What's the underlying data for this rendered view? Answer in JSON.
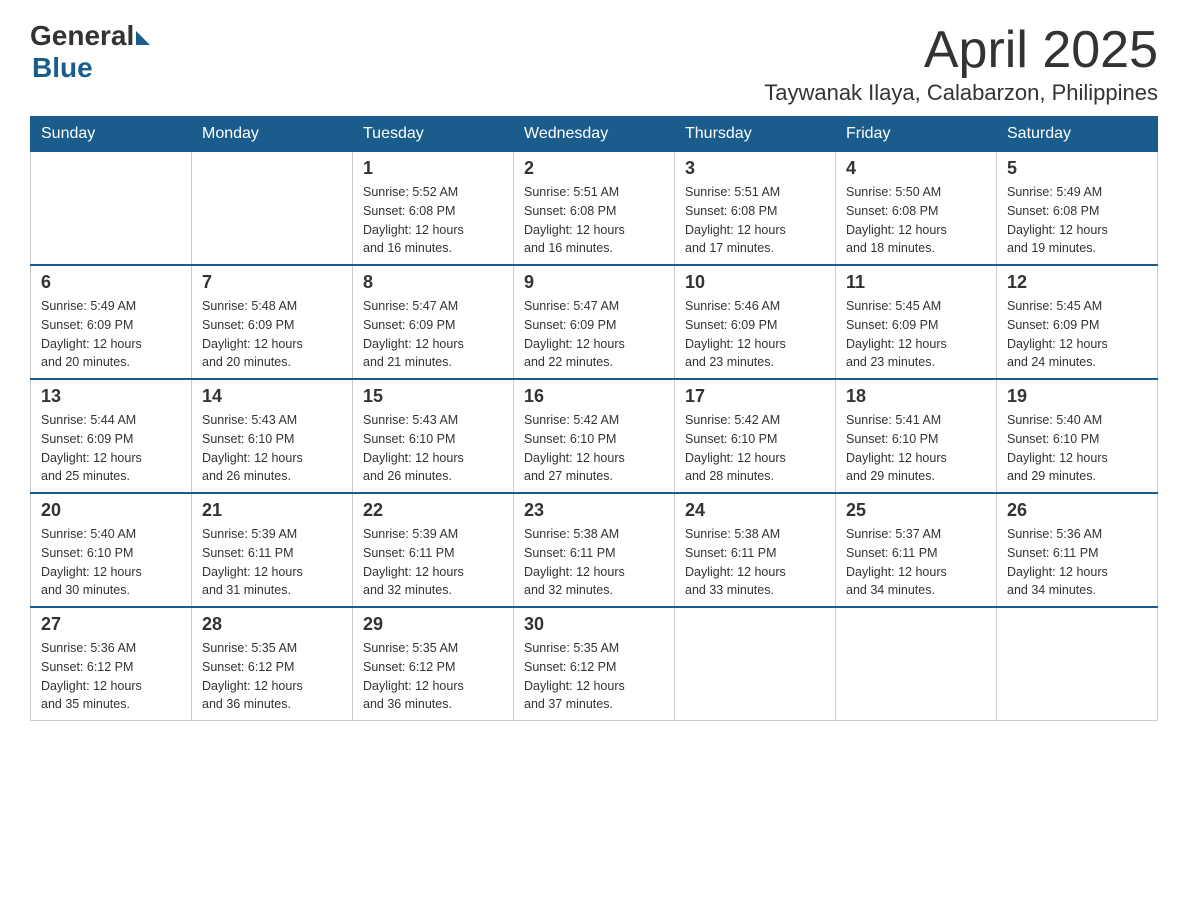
{
  "logo": {
    "general": "General",
    "blue": "Blue"
  },
  "title": "April 2025",
  "location": "Taywanak Ilaya, Calabarzon, Philippines",
  "weekdays": [
    "Sunday",
    "Monday",
    "Tuesday",
    "Wednesday",
    "Thursday",
    "Friday",
    "Saturday"
  ],
  "weeks": [
    [
      {
        "day": "",
        "info": ""
      },
      {
        "day": "",
        "info": ""
      },
      {
        "day": "1",
        "info": "Sunrise: 5:52 AM\nSunset: 6:08 PM\nDaylight: 12 hours\nand 16 minutes."
      },
      {
        "day": "2",
        "info": "Sunrise: 5:51 AM\nSunset: 6:08 PM\nDaylight: 12 hours\nand 16 minutes."
      },
      {
        "day": "3",
        "info": "Sunrise: 5:51 AM\nSunset: 6:08 PM\nDaylight: 12 hours\nand 17 minutes."
      },
      {
        "day": "4",
        "info": "Sunrise: 5:50 AM\nSunset: 6:08 PM\nDaylight: 12 hours\nand 18 minutes."
      },
      {
        "day": "5",
        "info": "Sunrise: 5:49 AM\nSunset: 6:08 PM\nDaylight: 12 hours\nand 19 minutes."
      }
    ],
    [
      {
        "day": "6",
        "info": "Sunrise: 5:49 AM\nSunset: 6:09 PM\nDaylight: 12 hours\nand 20 minutes."
      },
      {
        "day": "7",
        "info": "Sunrise: 5:48 AM\nSunset: 6:09 PM\nDaylight: 12 hours\nand 20 minutes."
      },
      {
        "day": "8",
        "info": "Sunrise: 5:47 AM\nSunset: 6:09 PM\nDaylight: 12 hours\nand 21 minutes."
      },
      {
        "day": "9",
        "info": "Sunrise: 5:47 AM\nSunset: 6:09 PM\nDaylight: 12 hours\nand 22 minutes."
      },
      {
        "day": "10",
        "info": "Sunrise: 5:46 AM\nSunset: 6:09 PM\nDaylight: 12 hours\nand 23 minutes."
      },
      {
        "day": "11",
        "info": "Sunrise: 5:45 AM\nSunset: 6:09 PM\nDaylight: 12 hours\nand 23 minutes."
      },
      {
        "day": "12",
        "info": "Sunrise: 5:45 AM\nSunset: 6:09 PM\nDaylight: 12 hours\nand 24 minutes."
      }
    ],
    [
      {
        "day": "13",
        "info": "Sunrise: 5:44 AM\nSunset: 6:09 PM\nDaylight: 12 hours\nand 25 minutes."
      },
      {
        "day": "14",
        "info": "Sunrise: 5:43 AM\nSunset: 6:10 PM\nDaylight: 12 hours\nand 26 minutes."
      },
      {
        "day": "15",
        "info": "Sunrise: 5:43 AM\nSunset: 6:10 PM\nDaylight: 12 hours\nand 26 minutes."
      },
      {
        "day": "16",
        "info": "Sunrise: 5:42 AM\nSunset: 6:10 PM\nDaylight: 12 hours\nand 27 minutes."
      },
      {
        "day": "17",
        "info": "Sunrise: 5:42 AM\nSunset: 6:10 PM\nDaylight: 12 hours\nand 28 minutes."
      },
      {
        "day": "18",
        "info": "Sunrise: 5:41 AM\nSunset: 6:10 PM\nDaylight: 12 hours\nand 29 minutes."
      },
      {
        "day": "19",
        "info": "Sunrise: 5:40 AM\nSunset: 6:10 PM\nDaylight: 12 hours\nand 29 minutes."
      }
    ],
    [
      {
        "day": "20",
        "info": "Sunrise: 5:40 AM\nSunset: 6:10 PM\nDaylight: 12 hours\nand 30 minutes."
      },
      {
        "day": "21",
        "info": "Sunrise: 5:39 AM\nSunset: 6:11 PM\nDaylight: 12 hours\nand 31 minutes."
      },
      {
        "day": "22",
        "info": "Sunrise: 5:39 AM\nSunset: 6:11 PM\nDaylight: 12 hours\nand 32 minutes."
      },
      {
        "day": "23",
        "info": "Sunrise: 5:38 AM\nSunset: 6:11 PM\nDaylight: 12 hours\nand 32 minutes."
      },
      {
        "day": "24",
        "info": "Sunrise: 5:38 AM\nSunset: 6:11 PM\nDaylight: 12 hours\nand 33 minutes."
      },
      {
        "day": "25",
        "info": "Sunrise: 5:37 AM\nSunset: 6:11 PM\nDaylight: 12 hours\nand 34 minutes."
      },
      {
        "day": "26",
        "info": "Sunrise: 5:36 AM\nSunset: 6:11 PM\nDaylight: 12 hours\nand 34 minutes."
      }
    ],
    [
      {
        "day": "27",
        "info": "Sunrise: 5:36 AM\nSunset: 6:12 PM\nDaylight: 12 hours\nand 35 minutes."
      },
      {
        "day": "28",
        "info": "Sunrise: 5:35 AM\nSunset: 6:12 PM\nDaylight: 12 hours\nand 36 minutes."
      },
      {
        "day": "29",
        "info": "Sunrise: 5:35 AM\nSunset: 6:12 PM\nDaylight: 12 hours\nand 36 minutes."
      },
      {
        "day": "30",
        "info": "Sunrise: 5:35 AM\nSunset: 6:12 PM\nDaylight: 12 hours\nand 37 minutes."
      },
      {
        "day": "",
        "info": ""
      },
      {
        "day": "",
        "info": ""
      },
      {
        "day": "",
        "info": ""
      }
    ]
  ]
}
